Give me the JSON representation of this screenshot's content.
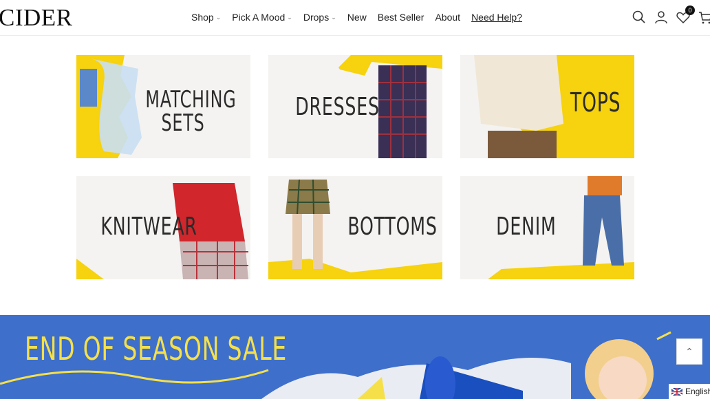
{
  "brand": {
    "logo": "CIDER"
  },
  "nav": {
    "items": [
      {
        "label": "Shop",
        "has_dropdown": true
      },
      {
        "label": "Pick A Mood",
        "has_dropdown": true
      },
      {
        "label": "Drops",
        "has_dropdown": true
      },
      {
        "label": "New",
        "has_dropdown": false
      },
      {
        "label": "Best Seller",
        "has_dropdown": false
      },
      {
        "label": "About",
        "has_dropdown": false
      }
    ],
    "help": "Need Help?"
  },
  "header_icons": {
    "search": "search-icon",
    "account": "user-icon",
    "wishlist": "heart-icon",
    "wishlist_count": "0",
    "cart": "cart-icon"
  },
  "categories": [
    {
      "line1": "MATCHING",
      "line2": "SETS"
    },
    {
      "line1": "DRESSES",
      "line2": ""
    },
    {
      "line1": "TOPS",
      "line2": ""
    },
    {
      "line1": "KNITWEAR",
      "line2": ""
    },
    {
      "line1": "BOTTOMS",
      "line2": ""
    },
    {
      "line1": "DENIM",
      "line2": ""
    }
  ],
  "banner": {
    "title": "END OF SEASON SALE"
  },
  "language": {
    "label": "English"
  },
  "colors": {
    "accent_yellow": "#f6d20f",
    "banner_blue": "#3e6fcb",
    "sale_yellow": "#f5e04a"
  }
}
